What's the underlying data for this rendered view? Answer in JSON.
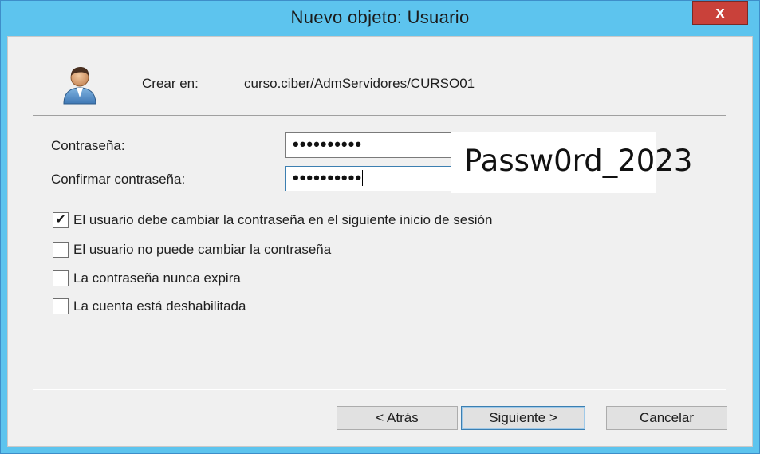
{
  "window": {
    "title": "Nuevo objeto: Usuario",
    "close_label": "x"
  },
  "header": {
    "icon": "user-icon",
    "crear_label": "Crear en:",
    "path": "curso.ciber/AdmServidores/CURSO01"
  },
  "form": {
    "password_label": "Contraseña:",
    "password_value": "••••••••••",
    "confirm_label": "Confirmar contraseña:",
    "confirm_value": "••••••••••",
    "overlay_password": "Passw0rd_2023"
  },
  "options": [
    {
      "label": "El usuario debe cambiar la contraseña en el siguiente inicio de sesión",
      "checked": true
    },
    {
      "label": "El usuario no puede cambiar la contraseña",
      "checked": false
    },
    {
      "label": "La contraseña nunca expira",
      "checked": false
    },
    {
      "label": "La cuenta está deshabilitada",
      "checked": false
    }
  ],
  "buttons": {
    "back": "< Atrás",
    "next": "Siguiente >",
    "cancel": "Cancelar"
  },
  "colors": {
    "titlebar": "#5dc4ee",
    "close": "#c9413a",
    "dialog_bg": "#f0f0f0"
  }
}
